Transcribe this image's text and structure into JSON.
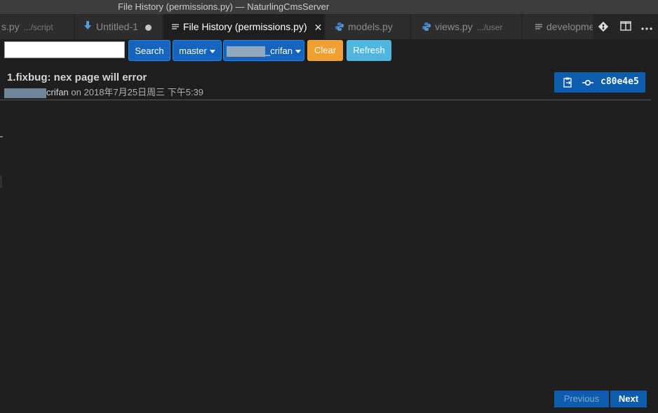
{
  "window": {
    "title": "File History (permissions.py) — NaturlingCmsServer"
  },
  "tabs": [
    {
      "label": "s.py",
      "desc": ".../script",
      "icon": "python-icon"
    },
    {
      "label": "Untitled-1",
      "icon": "download-arrow-icon",
      "dirty": true
    },
    {
      "label": "File History (permissions.py)",
      "icon": "lines-icon",
      "active": true
    },
    {
      "label": "models.py",
      "icon": "python-icon"
    },
    {
      "label": "views.py",
      "desc": ".../user",
      "icon": "python-icon"
    },
    {
      "label": "developme",
      "icon": "lines-icon"
    }
  ],
  "toolbar": {
    "search_value": "",
    "search_label": "Search",
    "branch_label": "master",
    "author_label": "_crifan",
    "clear_label": "Clear",
    "refresh_label": "Refresh"
  },
  "commit": {
    "message": "1.fixbug: nex page will error",
    "author": "crifan",
    "on_text": "on",
    "date": "2018年7月25日周三 下午5:39",
    "hash": "c80e4e5"
  },
  "pagination": {
    "previous_label": "Previous",
    "next_label": "Next"
  },
  "colors": {
    "accent": "#0e5cad",
    "clear": "#f0a030",
    "refresh": "#4fb6e0",
    "background": "#1e1e1e"
  }
}
